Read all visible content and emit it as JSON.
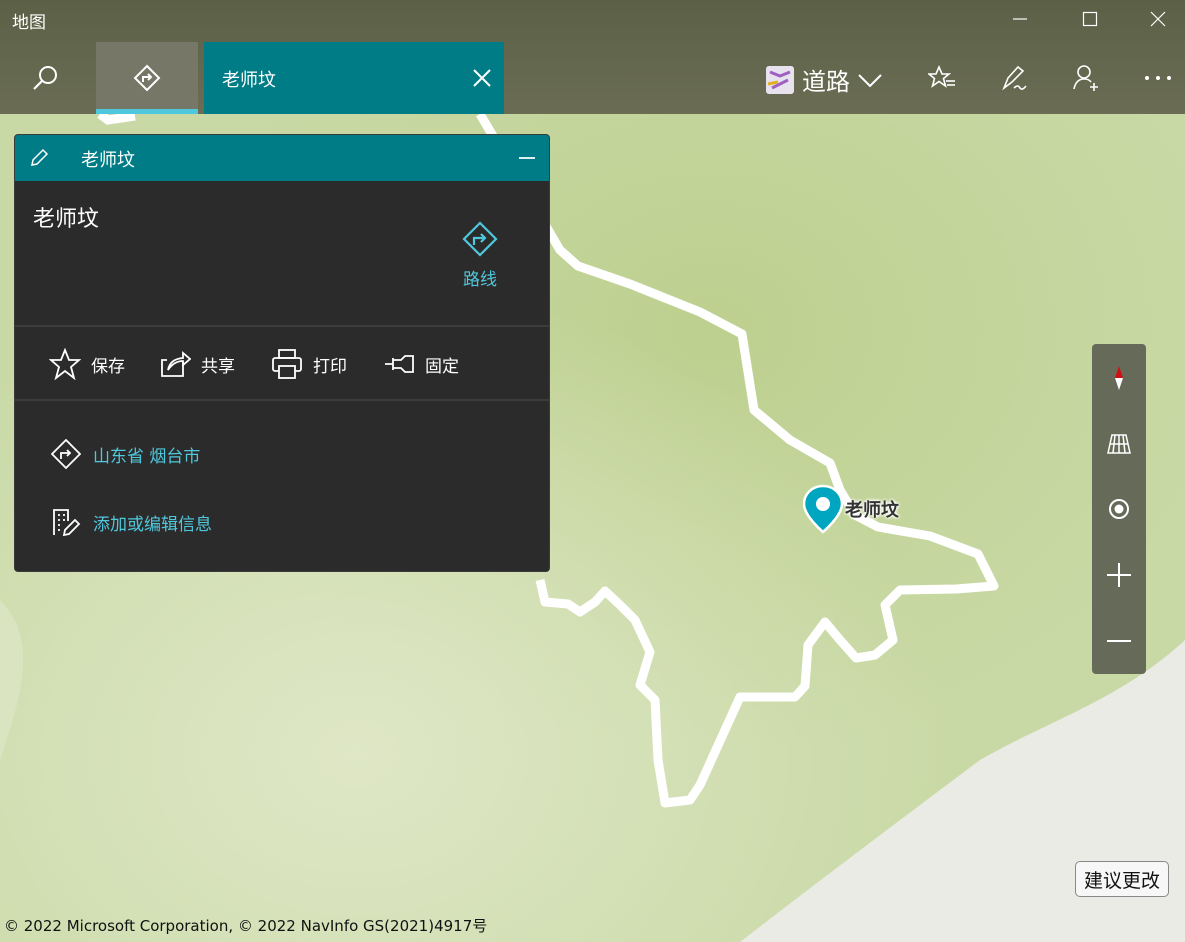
{
  "window": {
    "title": "地图"
  },
  "toolbar": {
    "search_tab_text": "老师坟",
    "layer_label": "道路"
  },
  "panel": {
    "header_title": "老师坟",
    "place_name": "老师坟",
    "route_label": "路线",
    "actions": [
      {
        "label": "保存",
        "icon": "star-icon"
      },
      {
        "label": "共享",
        "icon": "share-icon"
      },
      {
        "label": "打印",
        "icon": "printer-icon"
      },
      {
        "label": "固定",
        "icon": "pin-icon"
      }
    ],
    "address": "山东省 烟台市",
    "edit_info": "添加或编辑信息"
  },
  "map": {
    "pin_label": "老师坟",
    "suggest_label": "建议更改",
    "copyright": "© 2022 Microsoft Corporation, © 2022 NavInfo GS(2021)4917号",
    "accent_color": "#007c86",
    "link_color": "#4fc8de",
    "land_color": "#c9d9a6"
  }
}
